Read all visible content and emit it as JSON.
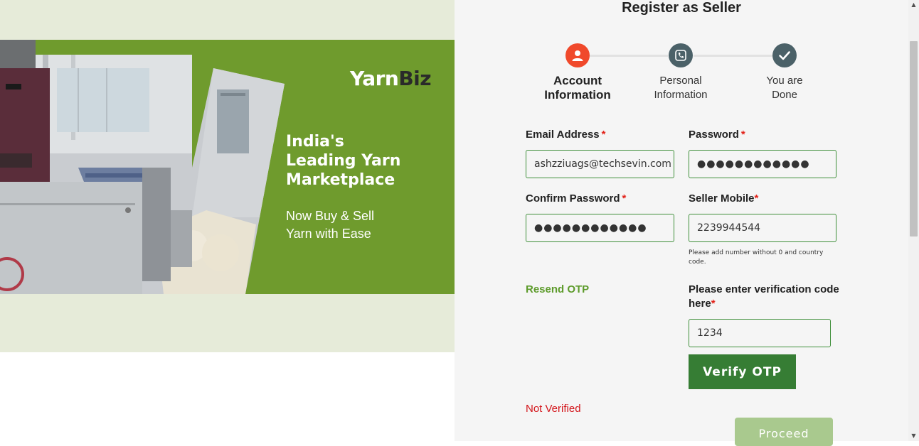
{
  "banner": {
    "logo_main": "Yarn",
    "logo_accent": "Biz",
    "headline": [
      "India's",
      "Leading Yarn",
      "Marketplace"
    ],
    "tagline": [
      "Now Buy & Sell",
      "Yarn with Ease"
    ]
  },
  "form": {
    "title": "Register as Seller",
    "steps": [
      {
        "label_line1": "Account",
        "label_line2": "Information",
        "icon": "user-icon",
        "color": "#f0492b"
      },
      {
        "label_line1": "Personal",
        "label_line2": "Information",
        "icon": "phone-icon",
        "color": "#4b6168"
      },
      {
        "label_line1": "You are",
        "label_line2": "Done",
        "icon": "check-icon",
        "color": "#4b6168"
      }
    ],
    "email": {
      "label": "Email Address",
      "required": "*",
      "value": "ashzziuags@techsevin.com"
    },
    "password": {
      "label": "Password",
      "required": "*",
      "value": "●●●●●●●●●●●●"
    },
    "confirm_password": {
      "label": "Confirm Password",
      "required": "*",
      "value": "●●●●●●●●●●●●"
    },
    "mobile": {
      "label": "Seller Mobile",
      "required": "*",
      "value": "2239944544",
      "hint": "Please add number without 0 and country code."
    },
    "resend_otp": "Resend OTP",
    "otp": {
      "label_line1": "Please enter verification code",
      "label_line2": "here",
      "required": "*",
      "value": "1234"
    },
    "verify_button": "Verify OTP",
    "status": "Not Verified",
    "proceed_button": "Proceed"
  }
}
